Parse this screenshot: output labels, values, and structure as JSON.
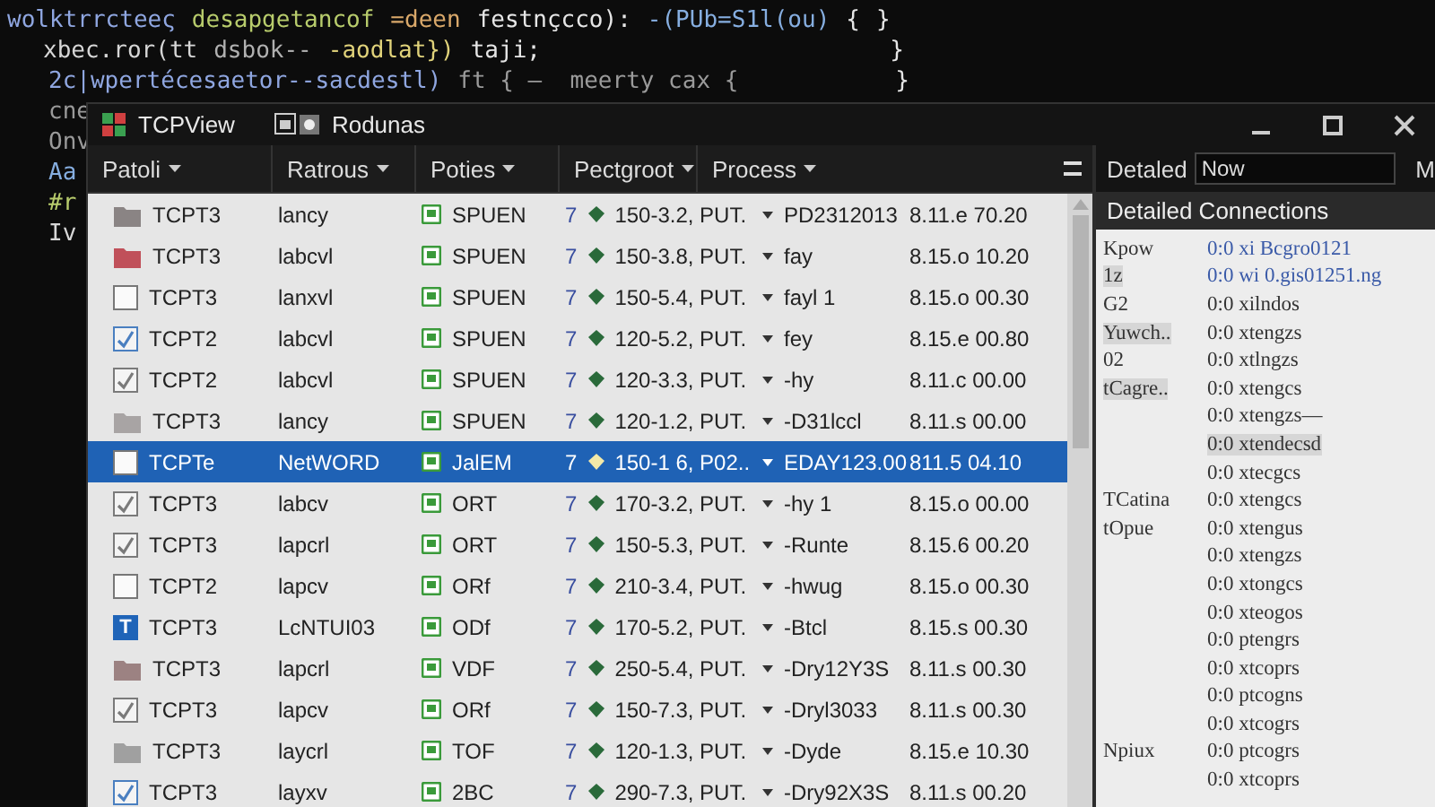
{
  "editor": {
    "lines": [
      {
        "segments": [
          {
            "text": "wolktrrcteeς",
            "color": "#8fa6e0"
          },
          {
            "text": "desapgetancof",
            "color": "#b8cc6c"
          },
          {
            "text": "=deen",
            "color": "#d9a86a"
          },
          {
            "text": "festnçcco):",
            "color": "#e6e6e6"
          },
          {
            "text": "-(PUb=S1l(ou)",
            "color": "#86aee0"
          },
          {
            "text": "{",
            "color": "#e6e6e6"
          }
        ],
        "end": "}"
      },
      {
        "segments": [
          {
            "text": "xbec.ror(tt",
            "color": "#d6d6d6"
          },
          {
            "text": "dsbok--",
            "color": "#b0b0b0"
          },
          {
            "text": "-aodlat})",
            "color": "#e0d27a"
          },
          {
            "text": "taji;",
            "color": "#e6e6e6"
          }
        ],
        "end": "}"
      },
      {
        "segments": [
          {
            "text": "2c|wpertécesaetor--sacdestl)",
            "color": "#8fa6e0"
          },
          {
            "text": "ft { —  meerty cax {",
            "color": "#9a9a9a"
          }
        ],
        "end": "}"
      },
      {
        "segments": [
          {
            "text": "cne",
            "color": "#9a9a9a"
          }
        ]
      },
      {
        "segments": [
          {
            "text": "Onv",
            "color": "#9a9a9a"
          }
        ]
      },
      {
        "segments": [
          {
            "text": "Aa",
            "color": "#86aee0"
          }
        ]
      },
      {
        "segments": [
          {
            "text": "#r",
            "color": "#b8cc6c"
          }
        ]
      },
      {
        "segments": [
          {
            "text": "Iv",
            "color": "#d6d6d6"
          }
        ]
      }
    ]
  },
  "window": {
    "title": "TCPView",
    "tab": "Rodunas"
  },
  "table": {
    "columns": [
      "Patoli",
      "Ratrous",
      "Poties",
      "Pectgroot",
      "Process"
    ],
    "rows": [
      {
        "icon": {
          "kind": "folder",
          "color": "#8a8484"
        },
        "cells": [
          "TCPT3",
          "lancy",
          "SPUEN",
          "7",
          "150-3.2, PUT.",
          "PD2312013",
          "8.11.e 70.20"
        ],
        "selected": false
      },
      {
        "icon": {
          "kind": "folder",
          "color": "#c0505a"
        },
        "cells": [
          "TCPT3",
          "labcvl",
          "SPUEN",
          "7",
          "150-3.8, PUT.",
          "fay",
          "8.15.o 10.20"
        ],
        "selected": false
      },
      {
        "icon": {
          "kind": "checkbox",
          "checked": false
        },
        "cells": [
          "TCPT3",
          "lanxvl",
          "SPUEN",
          "7",
          "150-5.4, PUT.",
          "fayl 1",
          "8.15.o 00.30"
        ],
        "selected": false
      },
      {
        "icon": {
          "kind": "checkbox",
          "checked": true,
          "color": "#4a7fc0"
        },
        "cells": [
          "TCPT2",
          "labcvl",
          "SPUEN",
          "7",
          "120-5.2, PUT.",
          "fey",
          "8.15.e 00.80"
        ],
        "selected": false
      },
      {
        "icon": {
          "kind": "checkbox",
          "checked": true,
          "color": "#7a7a7a"
        },
        "cells": [
          "TCPT2",
          "labcvl",
          "SPUEN",
          "7",
          "120-3.3, PUT.",
          "-hy",
          "8.11.c 00.00"
        ],
        "selected": false
      },
      {
        "icon": {
          "kind": "folder",
          "color": "#a8a4a4"
        },
        "cells": [
          "TCPT3",
          "lancy",
          "SPUEN",
          "7",
          "120-1.2, PUT.",
          "-D31lccl",
          "8.11.s 00.00"
        ],
        "selected": false
      },
      {
        "icon": {
          "kind": "checkbox",
          "checked": false
        },
        "cells": [
          "TCPTe",
          "NetWORD",
          "JalEM",
          "7",
          "150-1 6, P02..",
          "EDAY123.00",
          "811.5 04.10"
        ],
        "selected": true
      },
      {
        "icon": {
          "kind": "checkbox",
          "checked": true,
          "color": "#7a7a7a"
        },
        "cells": [
          "TCPT3",
          "labcv",
          "ORT",
          "7",
          "170-3.2, PUT.",
          "-hy 1",
          "8.15.o 00.00"
        ],
        "selected": false
      },
      {
        "icon": {
          "kind": "checkbox",
          "checked": true,
          "color": "#7a7a7a"
        },
        "cells": [
          "TCPT3",
          "lapcrl",
          "ORT",
          "7",
          "150-5.3, PUT.",
          "-Runte",
          "8.15.6 00.20"
        ],
        "selected": false
      },
      {
        "icon": {
          "kind": "checkbox",
          "checked": false
        },
        "cells": [
          "TCPT2",
          "lapcv",
          "ORf",
          "7",
          "210-3.4, PUT.",
          "-hwug",
          "8.15.o 00.30"
        ],
        "selected": false
      },
      {
        "icon": {
          "kind": "tile",
          "text": "T",
          "color": "#1f64b8"
        },
        "cells": [
          "TCPT3",
          "LcNTUI03",
          "ODf",
          "7",
          "170-5.2, PUT.",
          "-Btcl",
          "8.15.s 00.30"
        ],
        "selected": false
      },
      {
        "icon": {
          "kind": "folder",
          "color": "#9c8282"
        },
        "cells": [
          "TCPT3",
          "lapcrl",
          "VDF",
          "7",
          "250-5.4, PUT.",
          "-Dry12Y3S",
          "8.11.s 00.30"
        ],
        "selected": false
      },
      {
        "icon": {
          "kind": "checkbox",
          "checked": true,
          "color": "#7a7a7a"
        },
        "cells": [
          "TCPT3",
          "lapcv",
          "ORf",
          "7",
          "150-7.3, PUT.",
          "-Dryl3033",
          "8.11.s 00.30"
        ],
        "selected": false
      },
      {
        "icon": {
          "kind": "folder",
          "color": "#a0a0a0"
        },
        "cells": [
          "TCPT3",
          "laycrl",
          "TOF",
          "7",
          "120-1.3, PUT.",
          "-Dyde",
          "8.15.e 10.30"
        ],
        "selected": false
      },
      {
        "icon": {
          "kind": "checkbox",
          "checked": true,
          "color": "#4a7fc0"
        },
        "cells": [
          "TCPT3",
          "layxv",
          "2BC",
          "7",
          "290-7.3, PUT.",
          "-Dry92X3S",
          "8.11.s 00.20"
        ],
        "selected": false
      }
    ]
  },
  "details": {
    "label": "Detaled",
    "field": {
      "value": "Now"
    },
    "cut_text": "M",
    "title": "Detailed Connections",
    "rows": [
      {
        "key": "Kpow",
        "value": "0:0 xi Bcgro0121",
        "link": true,
        "highlighted": false
      },
      {
        "key": "1z",
        "value": "0:0 wi 0.gis01251.ng",
        "link": true,
        "highlighted": true
      },
      {
        "key": "G2",
        "value": "0:0 xilndos",
        "link": false,
        "highlighted": false
      },
      {
        "key": "Yuwch..",
        "value": "0:0 xtengzs",
        "link": false,
        "highlighted": true
      },
      {
        "key": "02",
        "value": "0:0 xtlngzs",
        "link": false,
        "highlighted": false
      },
      {
        "key": "tCagre..",
        "value": "0:0 xtengcs",
        "link": false,
        "highlighted": true
      },
      {
        "value": "0:0 xtengzs—",
        "link": false,
        "highlighted": false
      },
      {
        "value": "0:0 xtendecsd",
        "link": false,
        "highlighted": true
      },
      {
        "value": "0:0 xtecgcs",
        "link": false,
        "highlighted": false
      },
      {
        "key": "TCatina",
        "value": "0:0 xtengcs",
        "link": false,
        "highlighted": false
      },
      {
        "key": "tOpue",
        "value": "0:0 xtengus",
        "link": false,
        "highlighted": false
      },
      {
        "value": "0:0 xtengzs",
        "link": false,
        "highlighted": false
      },
      {
        "value": "0:0 xtongcs",
        "link": false,
        "highlighted": false
      },
      {
        "value": "0:0 xteogos",
        "link": false,
        "highlighted": false
      },
      {
        "value": "0:0 ptengrs",
        "link": false,
        "highlighted": false
      },
      {
        "value": "0:0 xtcoprs",
        "link": false,
        "highlighted": false
      },
      {
        "value": "0:0 ptcogns",
        "link": false,
        "highlighted": false
      },
      {
        "value": "0:0 xtcogrs",
        "link": false,
        "highlighted": false
      },
      {
        "key": "Npiux",
        "value": "0:0 ptcogrs",
        "link": false,
        "highlighted": false
      },
      {
        "value": "0:0 xtcoprs",
        "link": false,
        "highlighted": false
      }
    ]
  }
}
